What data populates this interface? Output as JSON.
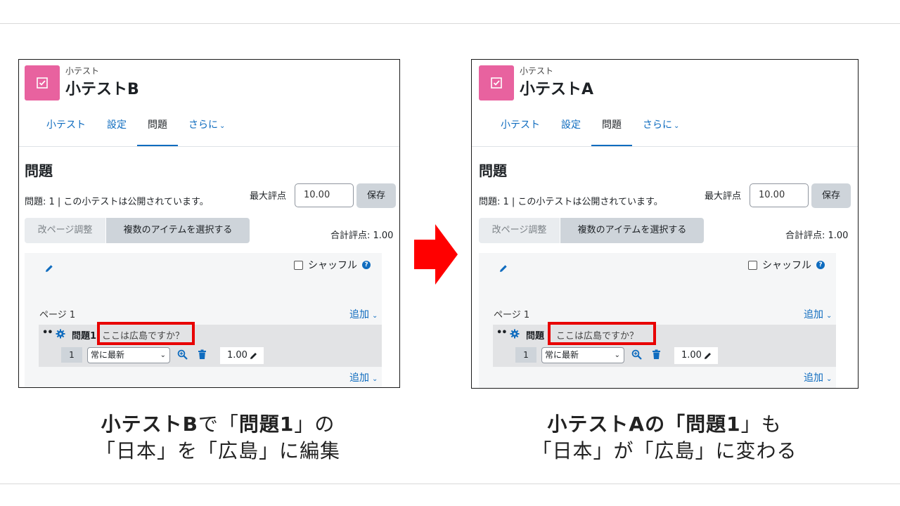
{
  "panels": {
    "left": {
      "module_label": "小テスト",
      "quiz_title": "小テストB",
      "tabs": [
        "小テスト",
        "設定",
        "問題",
        "さらに"
      ],
      "heading": "問題",
      "status_text": "問題: 1 | この小テストは公開されています。",
      "max_grade_label": "最大評点",
      "max_grade_value": "10.00",
      "save_label": "保存",
      "repaginate_label": "改ページ調整",
      "select_multiple_label": "複数のアイテムを選択する",
      "total_grade": "合計評点: 1.00",
      "shuffle_label": "シャッフル",
      "page_label": "ページ 1",
      "add_label": "追加",
      "question_name": "問題1",
      "question_text": "ここは広島ですか？",
      "slot_number": "1",
      "version_select": "常に最新",
      "mark": "1.00"
    },
    "right": {
      "module_label": "小テスト",
      "quiz_title": "小テストA",
      "tabs": [
        "小テスト",
        "設定",
        "問題",
        "さらに"
      ],
      "heading": "問題",
      "status_text": "問題: 1 | この小テストは公開されています。",
      "max_grade_label": "最大評点",
      "max_grade_value": "10.00",
      "save_label": "保存",
      "repaginate_label": "改ページ調整",
      "select_multiple_label": "複数のアイテムを選択する",
      "total_grade": "合計評点: 1.00",
      "shuffle_label": "シャッフル",
      "page_label": "ページ 1",
      "add_label": "追加",
      "question_name": "問題",
      "question_text": "ここは広島ですか？",
      "slot_number": "1",
      "version_select": "常に最新",
      "mark": "1.00"
    }
  },
  "captions": {
    "left": {
      "line1_bold_a": "小テストB",
      "line1_a": "で「",
      "line1_bold_b": "問題1",
      "line1_b": "」の",
      "line2": "「日本」を「広島」に編集"
    },
    "right": {
      "line1_bold_a": "小テストAの「",
      "line1_bold_b": "問題1",
      "line1_b": "」も",
      "line2": "「日本」が「広島」に変わる"
    }
  },
  "colors": {
    "accent": "#0f6cbf",
    "quiz_icon": "#e8629f",
    "highlight": "#e80000"
  }
}
